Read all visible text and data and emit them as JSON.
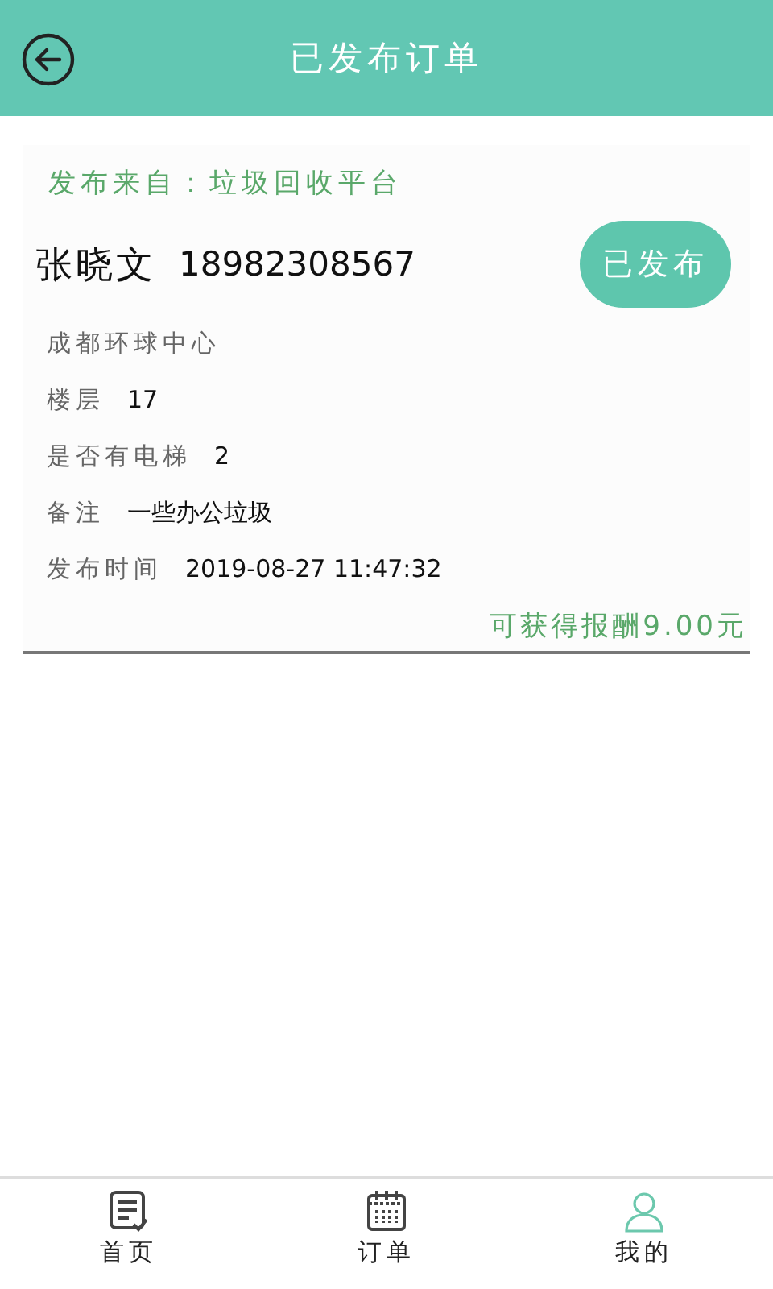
{
  "header": {
    "title": "已发布订单"
  },
  "order": {
    "source": "发布来自：垃圾回收平台",
    "name": "张晓文",
    "phone": "18982308567",
    "status_button": "已发布",
    "address": "成都环球中心",
    "fields": [
      {
        "label": "楼层",
        "value": "17"
      },
      {
        "label": "是否有电梯",
        "value": "2"
      },
      {
        "label": "备注",
        "value": "一些办公垃圾"
      },
      {
        "label": "发布时间",
        "value": "2019-08-27 11:47:32"
      }
    ],
    "reward": "可获得报酬9.00元"
  },
  "tabs": [
    {
      "label": "首页",
      "kind": "home",
      "selected": false
    },
    {
      "label": "订单",
      "kind": "calendar",
      "selected": false
    },
    {
      "label": "我的",
      "kind": "user",
      "selected": true
    }
  ]
}
